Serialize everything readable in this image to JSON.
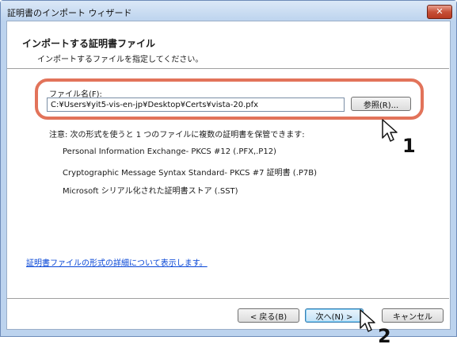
{
  "window": {
    "title": "証明書のインポート ウィザード",
    "close_glyph": "✕"
  },
  "header": {
    "title": "インポートする証明書ファイル",
    "subtitle": "インポートするファイルを指定してください。"
  },
  "file": {
    "label": "ファイル名(F):",
    "value": "C:¥Users¥yit5-vis-en-jp¥Desktop¥Certs¥vista-20.pfx",
    "browse_label": "参照(R)..."
  },
  "note": {
    "text": "注意: 次の形式を使うと 1 つのファイルに複数の証明書を保管できます:",
    "formats": [
      "Personal Information Exchange- PKCS #12 (.PFX,.P12)",
      "Cryptographic Message Syntax Standard- PKCS #7 証明書 (.P7B)",
      "Microsoft シリアル化された証明書ストア (.SST)"
    ]
  },
  "link": {
    "text": "証明書ファイルの形式の詳細について表示します。"
  },
  "footer": {
    "back_label": "< 戻る(B)",
    "next_label": "次へ(N) >",
    "cancel_label": "キャンセル"
  },
  "annotations": {
    "step1": "1",
    "step2": "2",
    "highlight_color": "#e2735a"
  }
}
